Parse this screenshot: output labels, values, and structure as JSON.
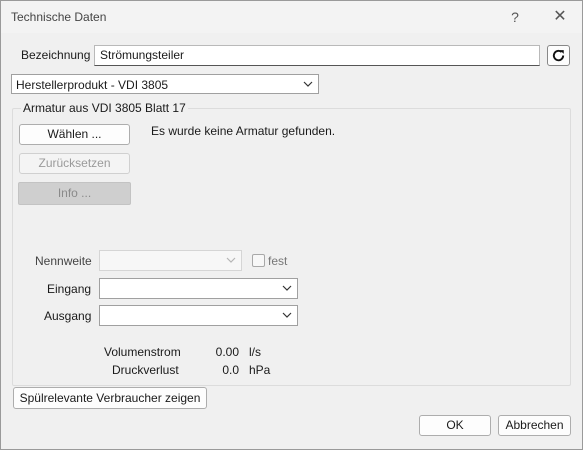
{
  "window": {
    "title": "Technische Daten",
    "help_glyph": "?",
    "close_glyph": "✕"
  },
  "bezeichnung": {
    "label": "Bezeichnung",
    "value": "Strömungsteiler",
    "refresh_icon": "refresh-icon"
  },
  "product_select": {
    "value": "Herstellerprodukt - VDI 3805"
  },
  "armatur": {
    "group_title": "Armatur aus VDI 3805 Blatt 17",
    "select_button": "Wählen ...",
    "reset_button": "Zurücksetzen",
    "info_button": "Info ...",
    "status_text": "Es wurde keine Armatur gefunden."
  },
  "form": {
    "nennweite_label": "Nennweite",
    "nennweite_value": "",
    "fest_label": "fest",
    "eingang_label": "Eingang",
    "eingang_value": "",
    "ausgang_label": "Ausgang",
    "ausgang_value": ""
  },
  "readouts": {
    "volumenstrom_label": "Volumenstrom",
    "volumenstrom_value": "0.00",
    "volumenstrom_unit": "l/s",
    "druckverlust_label": "Druckverlust",
    "druckverlust_value": "0.0",
    "druckverlust_unit": "hPa"
  },
  "footer": {
    "consumers_button": "Spülrelevante Verbraucher zeigen",
    "ok_button": "OK",
    "cancel_button": "Abbrechen"
  }
}
